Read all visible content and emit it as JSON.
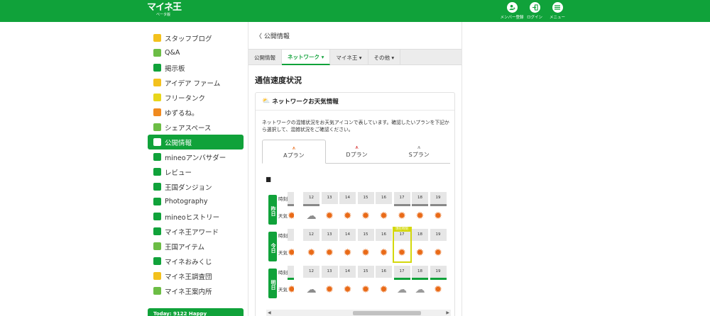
{
  "header": {
    "logo": "マイネ王",
    "logo_sub": "ベータ版",
    "buttons": [
      {
        "label": "メンバー登録"
      },
      {
        "label": "ログイン"
      },
      {
        "label": "メニュー"
      }
    ]
  },
  "sidebar": {
    "items": [
      {
        "label": "スタッフブログ",
        "color": "#f3c11d"
      },
      {
        "label": "Q&A",
        "color": "#6cbd45"
      },
      {
        "label": "掲示板",
        "color": "#10a23a"
      },
      {
        "label": "アイデア ファーム",
        "color": "#f3c11d"
      },
      {
        "label": "フリータンク",
        "color": "#e8d61b"
      },
      {
        "label": "ゆずるね。",
        "color": "#f08a1f"
      },
      {
        "label": "シェアスペース",
        "color": "#6cbd45"
      },
      {
        "label": "公開情報",
        "color": "#ffffff"
      },
      {
        "label": "mineoアンバサダー",
        "color": "#10a23a"
      },
      {
        "label": "レビュー",
        "color": "#10a23a"
      },
      {
        "label": "王国ダンジョン",
        "color": "#10a23a"
      },
      {
        "label": "Photography",
        "color": "#10a23a"
      },
      {
        "label": "mineoヒストリー",
        "color": "#10a23a"
      },
      {
        "label": "マイネ王アワード",
        "color": "#10a23a"
      },
      {
        "label": "王国アイテム",
        "color": "#6cbd45"
      },
      {
        "label": "マイネおみくじ",
        "color": "#10a23a"
      },
      {
        "label": "マイネ王調査団",
        "color": "#f3c11d"
      },
      {
        "label": "マイネ王案内所",
        "color": "#6cbd45"
      }
    ],
    "today": "Today: 9122 Happy"
  },
  "main": {
    "back_label": "公開情報",
    "tabs": [
      {
        "label": "公開情報"
      },
      {
        "label": "ネットワーク ▾"
      },
      {
        "label": "マイネ王 ▾"
      },
      {
        "label": "その他 ▾"
      }
    ],
    "section_title": "通信速度状況",
    "card": {
      "title": "ネットワークお天気情報",
      "desc": "ネットワークの混雑状況をお天気アイコンで表しています。確認したいプランを下記から選択して、混雑状況をご確認ください。",
      "plans": [
        {
          "label": "Aプラン",
          "color": "#e96a17"
        },
        {
          "label": "Dプラン",
          "color": "#d62b2b"
        },
        {
          "label": "Sプラン",
          "color": "#888888"
        }
      ],
      "hours_label": "時刻",
      "weather_label": "天気",
      "now_label": "現在時刻",
      "days": [
        {
          "label": "昨日",
          "hours": [
            "",
            "12",
            "13",
            "14",
            "15",
            "16",
            "17",
            "18",
            "19"
          ],
          "weather": [
            "sun",
            "rain",
            "sun",
            "sun",
            "sun",
            "sun",
            "sun",
            "sun",
            "sun"
          ],
          "bars": [
            "gray",
            "gray",
            "",
            "",
            "",
            "",
            "gray",
            "gray",
            "gray"
          ]
        },
        {
          "label": "今日",
          "hours": [
            "",
            "12",
            "13",
            "14",
            "15",
            "16",
            "17",
            "18",
            "19"
          ],
          "weather": [
            "sun",
            "sun",
            "sun",
            "sun",
            "sun",
            "sun",
            "sun",
            "sun",
            "sun"
          ],
          "bars": [
            "",
            "",
            "",
            "",
            "",
            "",
            "",
            "",
            ""
          ]
        },
        {
          "label": "明日",
          "hours": [
            "",
            "12",
            "13",
            "14",
            "15",
            "16",
            "17",
            "18",
            "19"
          ],
          "weather": [
            "sun",
            "rain",
            "sun",
            "sun",
            "sun",
            "sun",
            "cloud",
            "cloud",
            "sun"
          ],
          "bars": [
            "green",
            "",
            "",
            "",
            "",
            "",
            "green",
            "green",
            "green"
          ]
        }
      ]
    }
  }
}
